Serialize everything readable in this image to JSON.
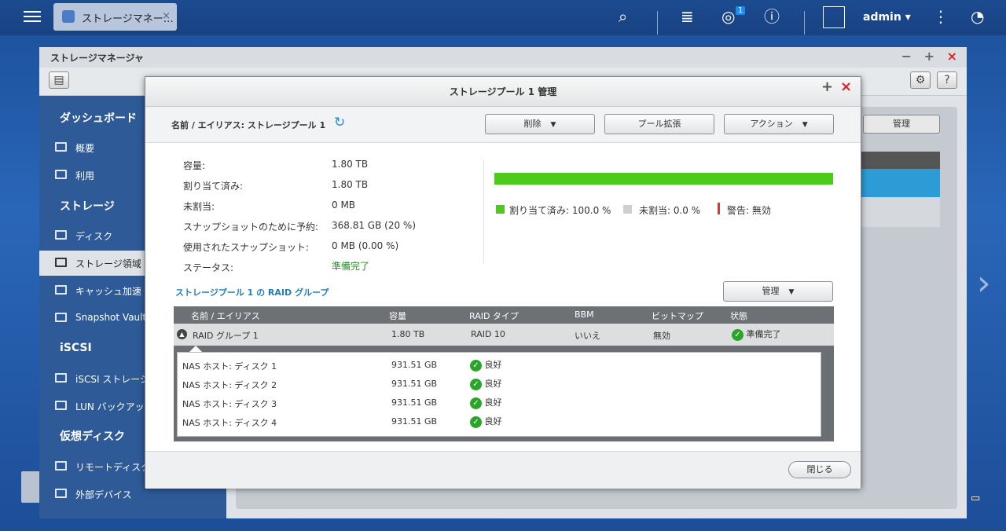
{
  "taskbar": {
    "app_tab_label": "ストレージマネー…",
    "app_tab_close": "×",
    "user_name": "admin",
    "notification_count": "1",
    "icons": [
      "hamburger-menu-icon",
      "search-icon",
      "stack-icon",
      "notification-icon",
      "info-icon",
      "user-icon",
      "more-icon",
      "dashboard-gauge-icon"
    ]
  },
  "main_window": {
    "title": "ストレージマネージャ",
    "controls": {
      "minimize": "−",
      "maximize": "+",
      "close": "×"
    },
    "bg_manage_label": "管理"
  },
  "sidebar": {
    "sections": [
      {
        "heading": "ダッシュボード",
        "items": [
          {
            "label": "概要",
            "icon": "overview-icon"
          },
          {
            "label": "利用",
            "icon": "usage-icon"
          }
        ]
      },
      {
        "heading": "ストレージ",
        "items": [
          {
            "label": "ディスク",
            "icon": "disk-icon"
          },
          {
            "label": "ストレージ領域",
            "icon": "storage-icon",
            "active": true
          },
          {
            "label": "キャッシュ加速",
            "icon": "cache-icon"
          },
          {
            "label": "Snapshot Vault",
            "icon": "vault-icon"
          }
        ]
      },
      {
        "heading": "iSCSI",
        "items": [
          {
            "label": "iSCSI ストレージ",
            "icon": "iscsi-icon"
          },
          {
            "label": "LUN バックアップ",
            "icon": "lun-backup-icon"
          }
        ]
      },
      {
        "heading": "仮想ディスク",
        "items": [
          {
            "label": "リモートディスク",
            "icon": "remote-disk-icon"
          },
          {
            "label": "外部デバイス",
            "icon": "external-device-icon"
          }
        ]
      }
    ]
  },
  "dialog": {
    "title": "ストレージプール 1 管理",
    "pool_name": "名前 / エイリアス: ストレージプール 1",
    "buttons": {
      "delete": "削除",
      "expand": "プール拡張",
      "action": "アクション",
      "manage": "管理",
      "close": "閉じる"
    },
    "info": [
      {
        "label": "容量:",
        "value": "1.80 TB"
      },
      {
        "label": "割り当て済み:",
        "value": "1.80 TB"
      },
      {
        "label": "未割当:",
        "value": "0 MB"
      },
      {
        "label": "スナップショットのために予約:",
        "value": "368.81 GB (20 %)"
      },
      {
        "label": "使用されたスナップショット:",
        "value": "0 MB (0.00 %)"
      },
      {
        "label": "ステータス:",
        "value": "準備完了"
      }
    ],
    "usage": {
      "allocated_fraction": 1.0,
      "allocated_color": "#4ecb1a",
      "unallocated_color": "#cfcfcf",
      "warning_color": "#d13c3c",
      "legend_allocated": "割り当て済み: 100.0 %",
      "legend_unallocated": "未割当: 0.0 %",
      "legend_warning": "警告: 無効"
    },
    "raid_title": "ストレージプール 1 の RAID グループ",
    "table": {
      "headers": [
        "名前 / エイリアス",
        "容量",
        "RAID タイプ",
        "BBM",
        "ビットマップ",
        "状態"
      ],
      "group": {
        "name": "RAID グループ 1",
        "capacity": "1.80 TB",
        "raid_type": "RAID 10",
        "bbm": "いいえ",
        "bitmap": "無効",
        "status": "準備完了"
      },
      "disks": [
        {
          "name": "NAS ホスト: ディスク 1",
          "capacity": "931.51 GB",
          "status": "良好"
        },
        {
          "name": "NAS ホスト: ディスク 2",
          "capacity": "931.51 GB",
          "status": "良好"
        },
        {
          "name": "NAS ホスト: ディスク 3",
          "capacity": "931.51 GB",
          "status": "良好"
        },
        {
          "name": "NAS ホスト: ディスク 4",
          "capacity": "931.51 GB",
          "status": "良好"
        }
      ]
    }
  }
}
